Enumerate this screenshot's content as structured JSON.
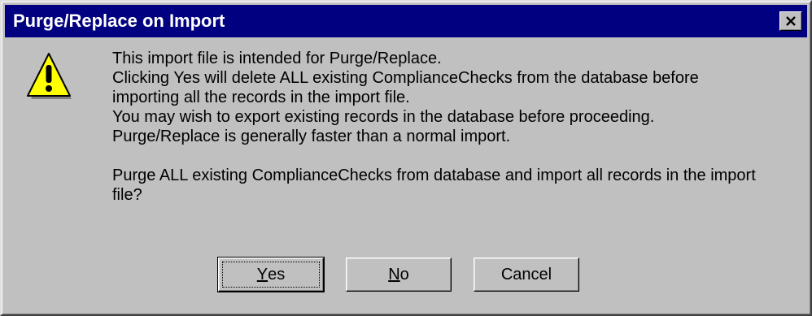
{
  "dialog": {
    "title": "Purge/Replace on Import",
    "close_glyph": "✕",
    "icon": "warning-icon",
    "message_lines": [
      "This import file is intended for Purge/Replace.",
      "Clicking Yes will delete ALL existing ComplianceChecks from the database before",
      "importing all the records in the import file.",
      "You may wish to export existing records in the database before proceeding.",
      "Purge/Replace is generally faster than a normal import."
    ],
    "question_line1": "Purge ALL existing ComplianceChecks from database and import all records in the import",
    "question_line2": "file?",
    "buttons": {
      "yes_mnemonic": "Y",
      "yes_rest": "es",
      "no_mnemonic": "N",
      "no_rest": "o",
      "cancel": "Cancel"
    }
  },
  "colors": {
    "face": "#c0c0c0",
    "titlebar": "#000080",
    "title_text": "#ffffff",
    "warning_fill": "#ffff00"
  }
}
